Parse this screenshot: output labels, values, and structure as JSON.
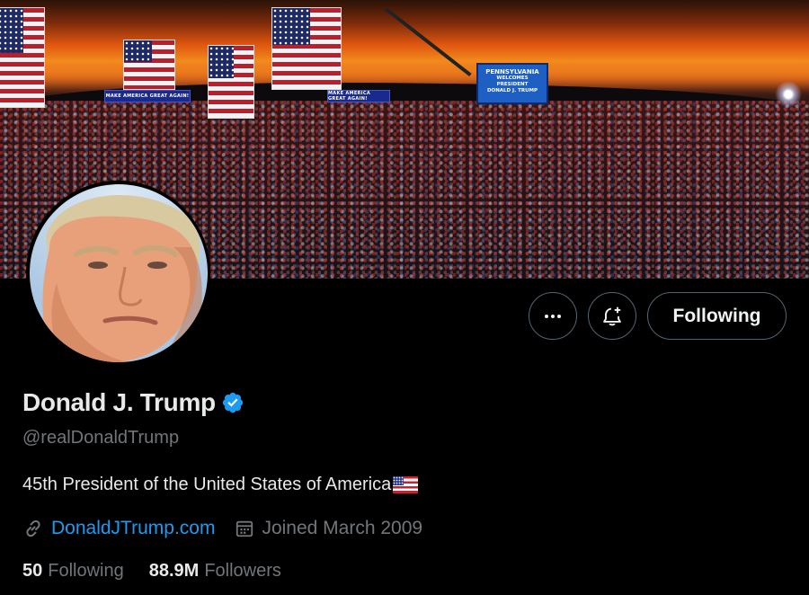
{
  "banner": {
    "sign_left": "MAKE AMERICA GREAT AGAIN!",
    "sign_right": "MAKE AMERICA GREAT AGAIN!",
    "screen_lines": [
      "PENNSYLVANIA",
      "WELCOMES",
      "PRESIDENT",
      "DONALD J. TRUMP"
    ]
  },
  "profile": {
    "display_name": "Donald J. Trump",
    "handle": "@realDonaldTrump",
    "bio": "45th President of the United States of America",
    "website": "DonaldJTrump.com",
    "joined": "Joined March 2009",
    "following_count": "50",
    "following_label": "Following",
    "followers_count": "88.9M",
    "followers_label": "Followers"
  },
  "actions": {
    "more_icon": "more-icon",
    "notify_icon": "bell-plus-icon",
    "follow_button_label": "Following"
  },
  "colors": {
    "background": "#000000",
    "accent": "#1d9bf0",
    "muted_text": "#71767b",
    "primary_text": "#e7e9ea",
    "border": "#536471"
  }
}
